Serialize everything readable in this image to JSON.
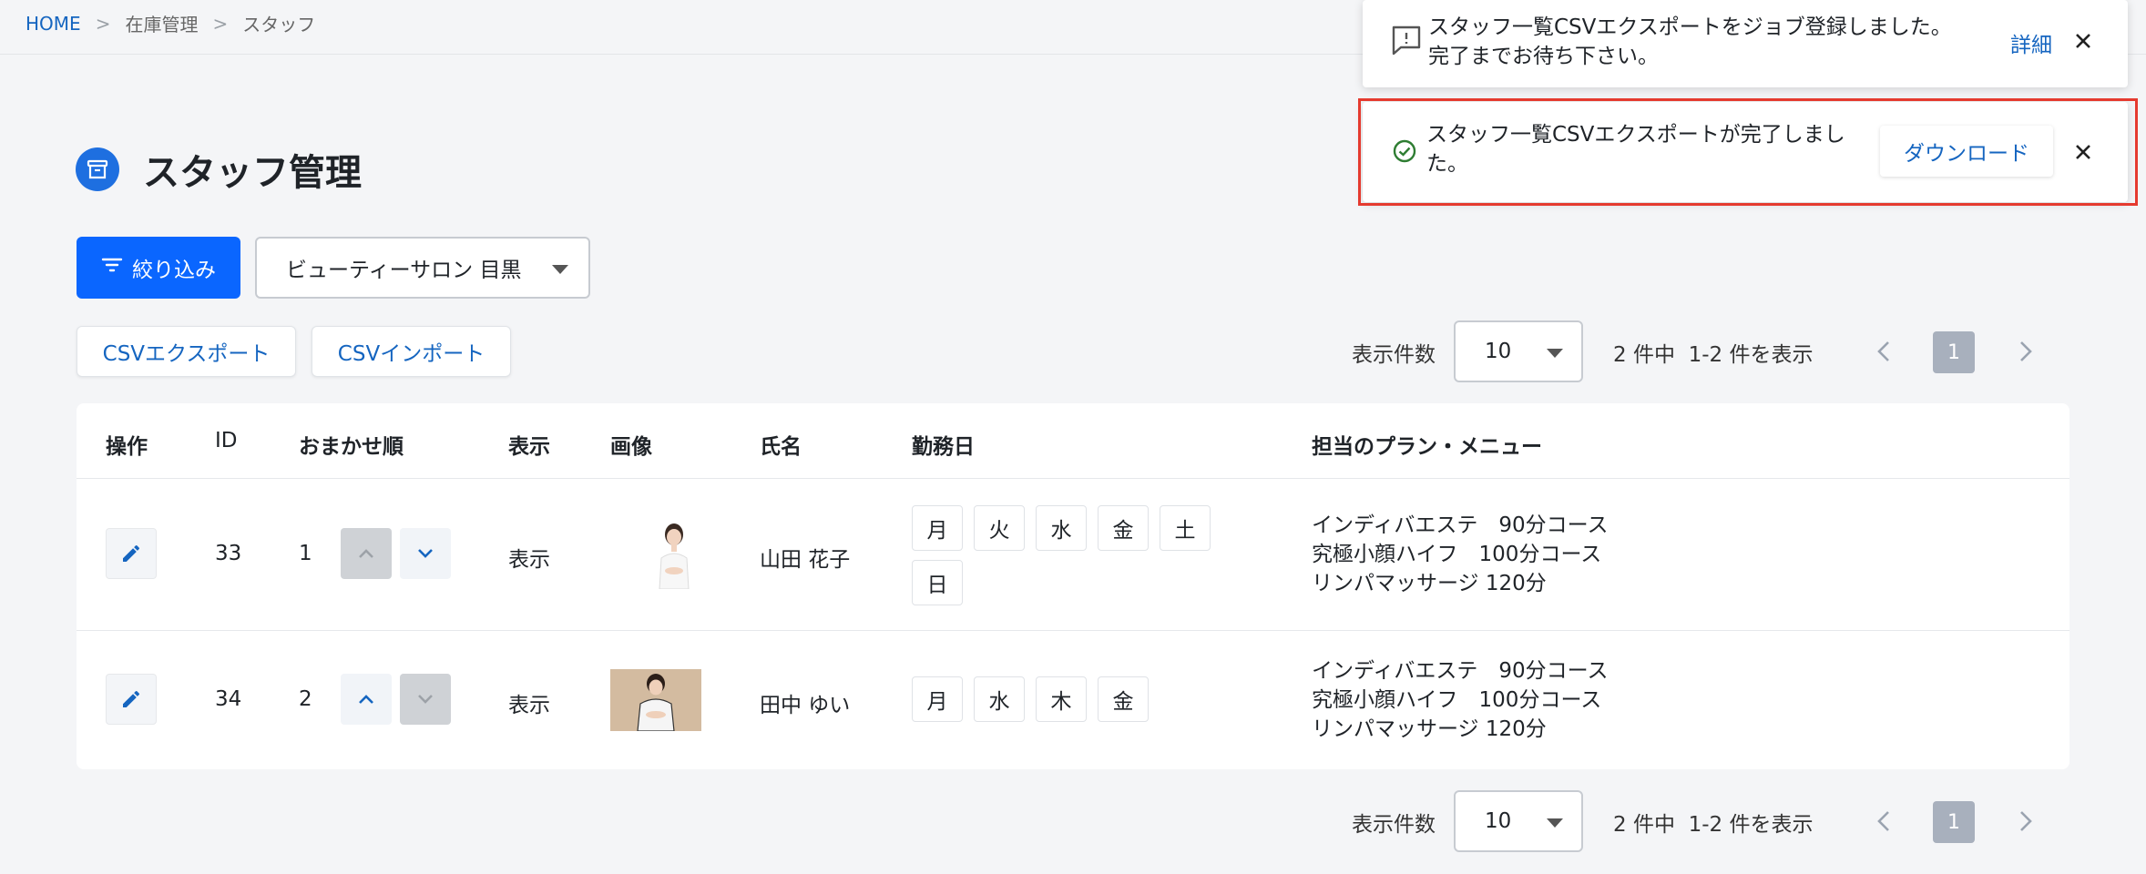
{
  "breadcrumb": {
    "home": "HOME",
    "section": "在庫管理",
    "page": "スタッフ",
    "sep": ">"
  },
  "page": {
    "title": "スタッフ管理"
  },
  "filter": {
    "button_label": "絞り込み",
    "store_selected": "ビューティーサロン 目黒"
  },
  "actions": {
    "csv_export": "CSVエクスポート",
    "csv_import": "CSVインポート"
  },
  "pager": {
    "size_label": "表示件数",
    "size_value": "10",
    "count_total": "2 件中",
    "count_range": "1-2 件を表示",
    "current_page": "1"
  },
  "table": {
    "headers": {
      "ops": "操作",
      "id": "ID",
      "order": "おまかせ順",
      "display": "表示",
      "image": "画像",
      "name": "氏名",
      "days": "勤務日",
      "plans": "担当のプラン・メニュー"
    },
    "rows": [
      {
        "id": "33",
        "order": "1",
        "display": "表示",
        "name": "山田 花子",
        "days": [
          "月",
          "火",
          "水",
          "金",
          "土",
          "日"
        ],
        "plans": [
          "インディバエステ　90分コース",
          "究極小顔ハイフ　100分コース",
          "リンパマッサージ 120分"
        ]
      },
      {
        "id": "34",
        "order": "2",
        "display": "表示",
        "name": "田中 ゆい",
        "days": [
          "月",
          "水",
          "木",
          "金"
        ],
        "plans": [
          "インディバエステ　90分コース",
          "究極小顔ハイフ　100分コース",
          "リンパマッサージ 120分"
        ]
      }
    ]
  },
  "toasts": {
    "job": {
      "line1": "スタッフ一覧CSVエクスポートをジョブ登録しました。",
      "line2": "完了までお待ち下さい。",
      "detail_link": "詳細"
    },
    "done": {
      "line1": "スタッフ一覧CSVエクスポートが完了しまし",
      "line2": "た。",
      "download": "ダウンロード"
    }
  },
  "colors": {
    "primary": "#0a66ff",
    "link": "#1565c0",
    "highlight": "#e53a2f",
    "success": "#2e7d32"
  }
}
